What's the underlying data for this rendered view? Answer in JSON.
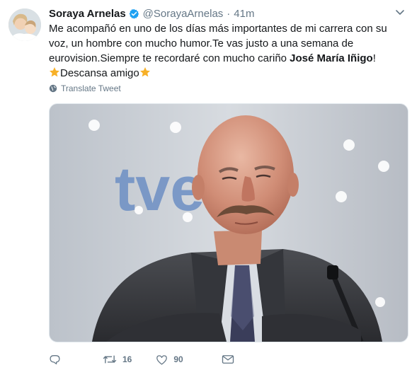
{
  "tweet": {
    "author_name": "Soraya Arnelas",
    "handle": "@SorayaArnelas",
    "separator": "·",
    "time": "41m",
    "text_part1": "Me acompañó en uno de los días más importantes de mi carrera con su voz, un hombre con mucho humor.Te vas justo a una semana de eurovision.Siempre te recordaré con mucho cariño ",
    "text_bold": "José María Iñigo",
    "text_part2": "!",
    "line2_text": "Descansa amigo",
    "translate_label": "Translate Tweet",
    "media_logo_text": "tve",
    "reply_count": "",
    "retweet_count": "16",
    "like_count": "90"
  },
  "icons": {
    "verified": "verified-badge-icon",
    "chevron": "chevron-down-icon",
    "globe": "globe-icon",
    "reply": "reply-icon",
    "retweet": "retweet-icon",
    "like": "heart-icon",
    "mail": "envelope-icon",
    "emoji": "star-emoji-icon"
  },
  "colors": {
    "text": "#14171a",
    "secondary": "#657786",
    "verified": "#1da1f2",
    "star": "#f7b027"
  }
}
